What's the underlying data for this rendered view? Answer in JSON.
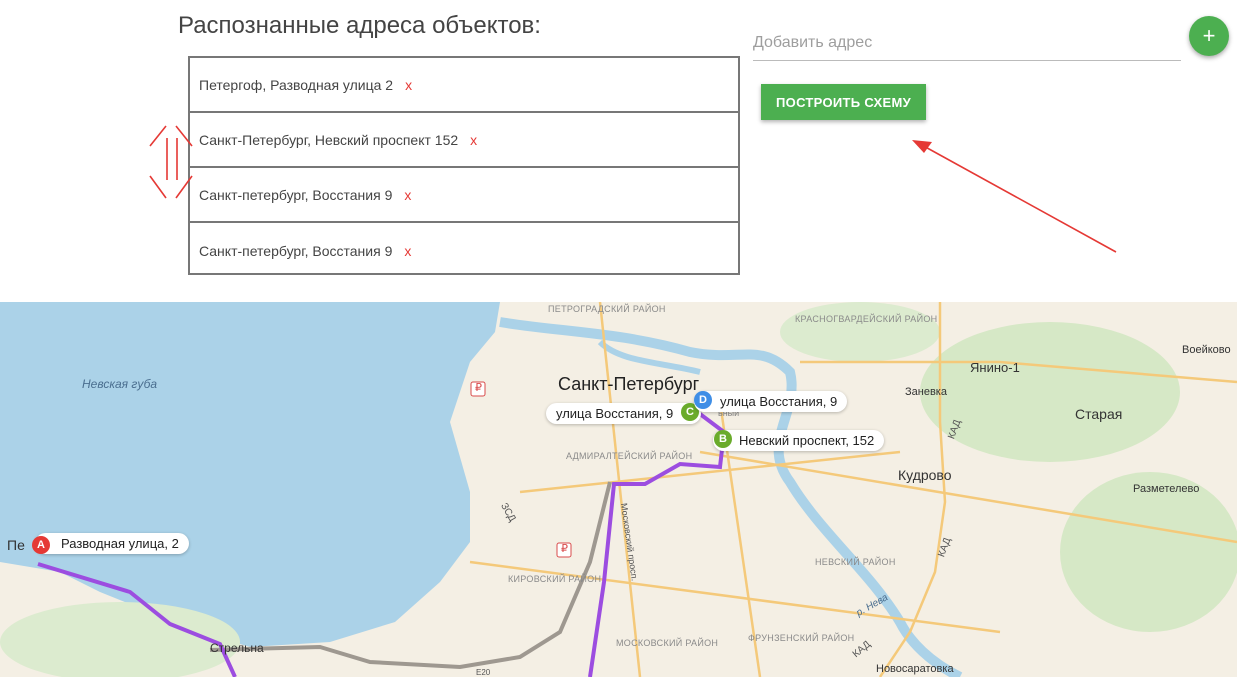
{
  "header": {
    "title": "Распознанные адреса объектов:"
  },
  "addresses": [
    {
      "text": "Петергоф, Разводная улица 2",
      "delete": "x"
    },
    {
      "text": "Санкт-Петербург, Невский проспект 152",
      "delete": "x"
    },
    {
      "text": "Санкт-петербург, Восстания 9",
      "delete": "x"
    },
    {
      "text": "Санкт-петербург, Восстания 9",
      "delete": "x"
    }
  ],
  "add_address": {
    "placeholder": "Добавить адрес",
    "fab_label": "+"
  },
  "build_button": {
    "label": "ПОСТРОИТЬ СХЕМУ"
  },
  "colors": {
    "accent": "#4caf50",
    "annotation": "#e53935",
    "route": "#9c4de0"
  },
  "map": {
    "city": "Санкт-Петербург",
    "water": "Невская губа",
    "districts": [
      "ПЕТРОГРАДСКИЙ РАЙОН",
      "КРАСНОГВАРДЕЙСКИЙ РАЙОН",
      "АДМИРАЛТЕЙСКИЙ РАЙОН",
      "КИРОВСКИЙ РАЙОН",
      "МОСКОВСКИЙ РАЙОН",
      "ФРУНЗЕНСКИЙ РАЙОН",
      "НЕВСКИЙ РАЙОН"
    ],
    "places": [
      "Янино-1",
      "Воейково",
      "Заневка",
      "Старая",
      "Кудрово",
      "Разметелево",
      "Новосаратовка",
      "Стрельна",
      "Пе"
    ],
    "roads": [
      "КАД",
      "КАД",
      "КАД",
      "ЗСД",
      "Московский просп.",
      "р. Нева",
      "E20"
    ],
    "river_fragment": "ьный",
    "markers": [
      {
        "letter": "A",
        "label": "Разводная улица, 2"
      },
      {
        "letter": "B",
        "label": "Невский проспект, 152"
      },
      {
        "letter": "C",
        "label": "улица Восстания, 9"
      },
      {
        "letter": "D",
        "label": "улица Восстания, 9"
      }
    ],
    "currency": "₽"
  }
}
